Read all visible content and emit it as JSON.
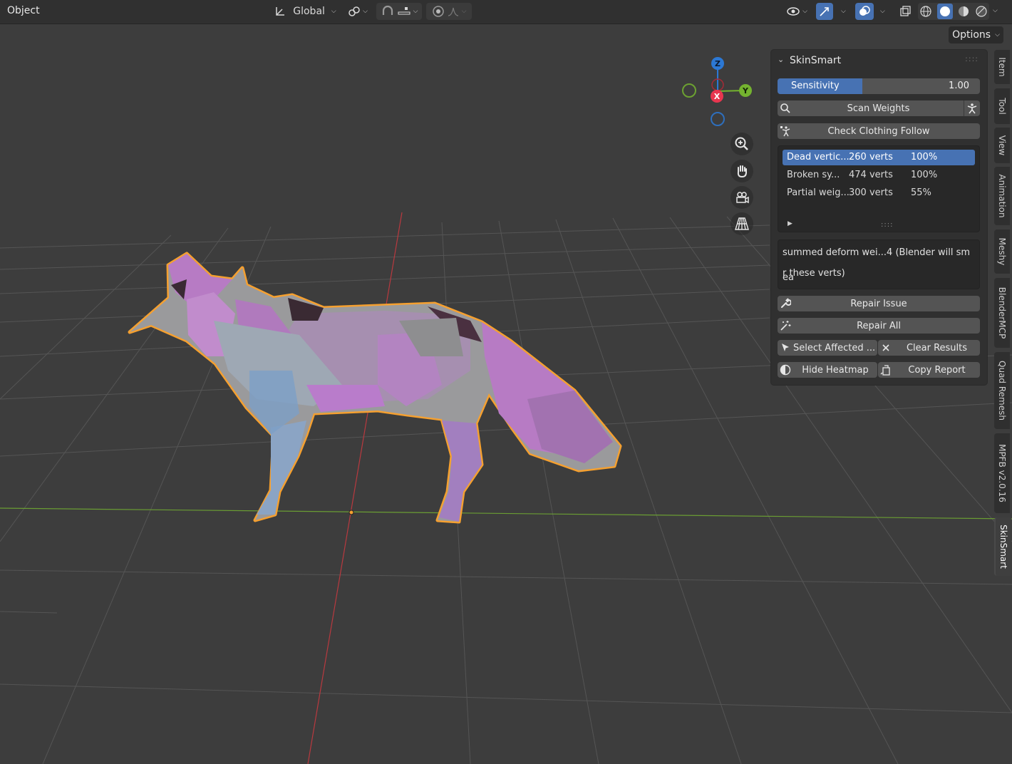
{
  "header": {
    "mode_label": "Object",
    "orientation_label": "Global"
  },
  "options_label": "Options",
  "gizmo": {
    "z": "Z",
    "y": "Y",
    "x": "X"
  },
  "panel": {
    "title": "SkinSmart",
    "sensitivity": {
      "label": "Sensitivity",
      "value": "1.00",
      "fraction": 0.42
    },
    "scan_label": "Scan Weights",
    "check_label": "Check Clothing Follow",
    "results": [
      {
        "name": "Dead vertic...",
        "count": "260 verts",
        "pct": "100%"
      },
      {
        "name": "Broken sy...",
        "count": "474 verts",
        "pct": "100%"
      },
      {
        "name": "Partial weig...",
        "count": "300 verts",
        "pct": "55%"
      }
    ],
    "message_line1": "summed deform wei...4 (Blender will smea",
    "message_line2": "r these verts)",
    "repair_issue_label": "Repair Issue",
    "repair_all_label": "Repair All",
    "select_affected_label": "Select Affected ...",
    "clear_results_label": "Clear Results",
    "hide_heatmap_label": "Hide Heatmap",
    "copy_report_label": "Copy Report"
  },
  "tabs": [
    "Item",
    "Tool",
    "View",
    "Animation",
    "Meshy",
    "BlenderMCP",
    "Quad Remesh",
    "MPFB v2.0.16",
    "SkinSmart"
  ],
  "colors": {
    "accent": "#4772b3",
    "selection_outline": "#f5a030",
    "mesh_heatmap": "#b77bc4",
    "x_axis": "#e8364f",
    "y_axis": "#74b32f",
    "z_axis": "#2c78d4"
  }
}
